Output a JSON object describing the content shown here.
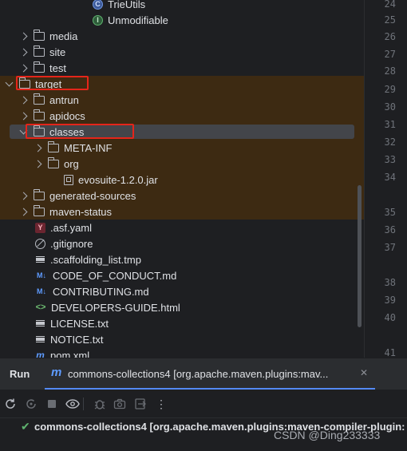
{
  "project_tree": {
    "items": [
      {
        "label": "TrieUtils",
        "kind": "class",
        "icon": "class-icon",
        "chevron": "none"
      },
      {
        "label": "Unmodifiable",
        "kind": "interface",
        "icon": "interface-icon",
        "chevron": "none"
      },
      {
        "label": "media",
        "kind": "folder",
        "icon": "folder-icon",
        "chevron": "collapsed"
      },
      {
        "label": "site",
        "kind": "folder",
        "icon": "folder-icon",
        "chevron": "collapsed"
      },
      {
        "label": "test",
        "kind": "folder",
        "icon": "folder-icon",
        "chevron": "collapsed"
      },
      {
        "label": "target",
        "kind": "folder",
        "icon": "folder-icon",
        "chevron": "expanded"
      },
      {
        "label": "antrun",
        "kind": "folder",
        "icon": "folder-icon",
        "chevron": "collapsed"
      },
      {
        "label": "apidocs",
        "kind": "folder",
        "icon": "folder-icon",
        "chevron": "collapsed"
      },
      {
        "label": "classes",
        "kind": "folder",
        "icon": "folder-icon",
        "chevron": "expanded",
        "selected": true
      },
      {
        "label": "META-INF",
        "kind": "folder",
        "icon": "folder-icon",
        "chevron": "collapsed"
      },
      {
        "label": "org",
        "kind": "folder",
        "icon": "folder-icon",
        "chevron": "collapsed"
      },
      {
        "label": "evosuite-1.2.0.jar",
        "kind": "jar",
        "icon": "jar-file-icon",
        "chevron": "none"
      },
      {
        "label": "generated-sources",
        "kind": "folder",
        "icon": "folder-icon",
        "chevron": "collapsed"
      },
      {
        "label": "maven-status",
        "kind": "folder",
        "icon": "folder-icon",
        "chevron": "collapsed"
      },
      {
        "label": ".asf.yaml",
        "kind": "yaml",
        "icon": "yaml-file-icon",
        "icon_text": "Y",
        "chevron": "none"
      },
      {
        "label": ".gitignore",
        "kind": "ignore",
        "icon": "gitignore-icon",
        "chevron": "none"
      },
      {
        "label": ".scaffolding_list.tmp",
        "kind": "text",
        "icon": "text-file-icon",
        "chevron": "none"
      },
      {
        "label": "CODE_OF_CONDUCT.md",
        "kind": "markdown",
        "icon": "markdown-icon",
        "icon_text": "M↓",
        "chevron": "none"
      },
      {
        "label": "CONTRIBUTING.md",
        "kind": "markdown",
        "icon": "markdown-icon",
        "icon_text": "M↓",
        "chevron": "none"
      },
      {
        "label": "DEVELOPERS-GUIDE.html",
        "kind": "html",
        "icon": "html-file-icon",
        "icon_text": "<>",
        "chevron": "none"
      },
      {
        "label": "LICENSE.txt",
        "kind": "text",
        "icon": "text-file-icon",
        "chevron": "none"
      },
      {
        "label": "NOTICE.txt",
        "kind": "text",
        "icon": "text-file-icon",
        "chevron": "none"
      },
      {
        "label": "pom.xml",
        "kind": "maven",
        "icon": "maven-pom-icon",
        "icon_text": "m",
        "chevron": "none"
      }
    ]
  },
  "gutter": {
    "line_numbers": [
      "24",
      "25",
      "26",
      "27",
      "28",
      "29",
      "30",
      "31",
      "32",
      "33",
      "34",
      "35",
      "36",
      "37",
      "38",
      "39",
      "40",
      "41"
    ]
  },
  "run_panel": {
    "title": "Run",
    "tab_icon_text": "m",
    "tab_label": "commons-collections4 [org.apache.maven.plugins:mav...",
    "close_glyph": "✕",
    "toolbar": {
      "rerun": "rerun-icon",
      "rerun_failed": "rerun-failed-icon",
      "stop": "stop-icon",
      "show": "eye-icon",
      "debug": "bug-icon",
      "screenshot": "camera-icon",
      "export": "export-icon",
      "more": "more-icon",
      "more_glyph": "⋮"
    },
    "result_check": "✔",
    "result_text": "commons-collections4 [org.apache.maven.plugins:maven-compiler-plugin:"
  },
  "watermark": "CSDN @Ding233333",
  "colors": {
    "target_highlight": "#3d2a12",
    "selection": "#43454a",
    "annotation_red": "#e5251a",
    "accent_blue": "#548af7",
    "success_green": "#5fb36f"
  }
}
